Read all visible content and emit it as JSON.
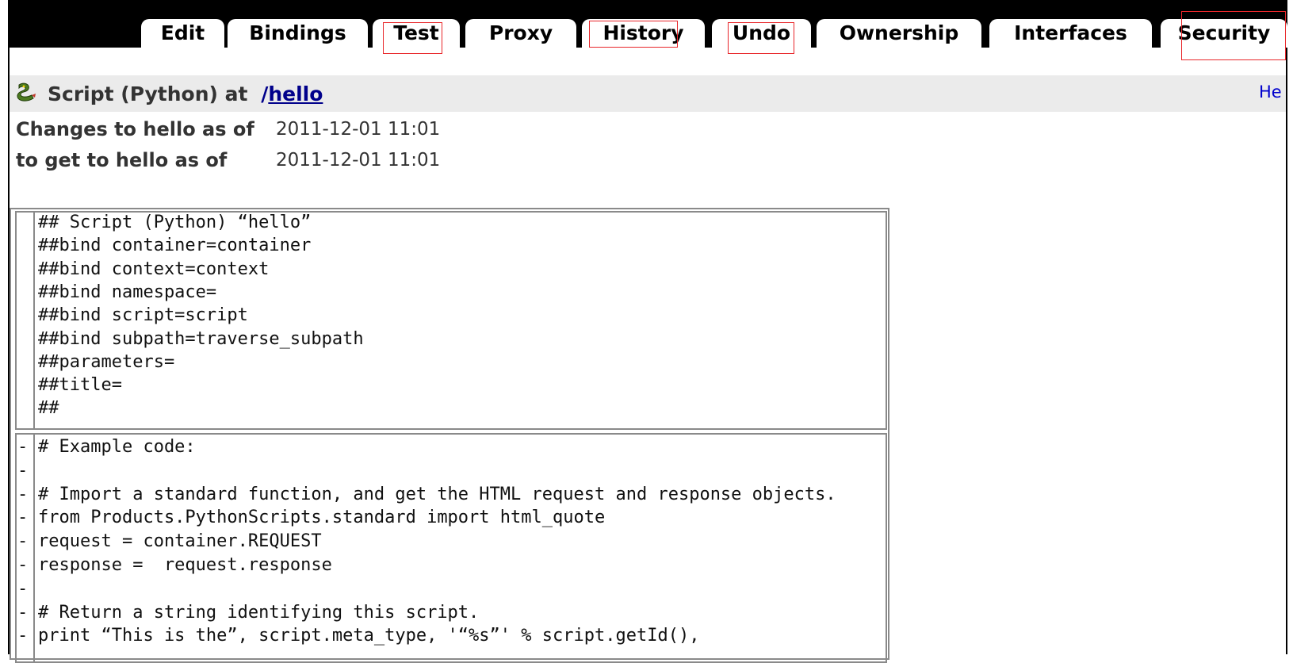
{
  "tabs": [
    {
      "label": "Edit"
    },
    {
      "label": "Bindings"
    },
    {
      "label": "Test"
    },
    {
      "label": "Proxy"
    },
    {
      "label": "History"
    },
    {
      "label": "Undo"
    },
    {
      "label": "Ownership"
    },
    {
      "label": "Interfaces"
    },
    {
      "label": "Security"
    }
  ],
  "header": {
    "object_type": "Script (Python) at",
    "path_sep": "/",
    "path_link": "hello",
    "help_link": "He"
  },
  "changes": {
    "from_label": "Changes to hello as of",
    "from_value": "2011-12-01 11:01",
    "to_label": "to get to hello as of",
    "to_value": "2011-12-01 11:01"
  },
  "diff": {
    "header_lines": [
      "## Script (Python) “hello”",
      "##bind container=container",
      "##bind context=context",
      "##bind namespace=",
      "##bind script=script",
      "##bind subpath=traverse_subpath",
      "##parameters=",
      "##title=",
      "##"
    ],
    "body_markers": [
      "-",
      "-",
      "-",
      "-",
      "-",
      "-",
      "-",
      "-",
      "-"
    ],
    "body_lines": [
      "# Example code:",
      "",
      "# Import a standard function, and get the HTML request and response objects.",
      "from Products.PythonScripts.standard import html_quote",
      "request = container.REQUEST",
      "response =  request.response",
      "",
      "# Return a string identifying this script.",
      "print “This is the”, script.meta_type, '“%s”' % script.getId(),"
    ]
  },
  "colors": {
    "highlight": "#e8262a",
    "titlebar_bg": "#ebebeb",
    "link": "#00008b"
  }
}
